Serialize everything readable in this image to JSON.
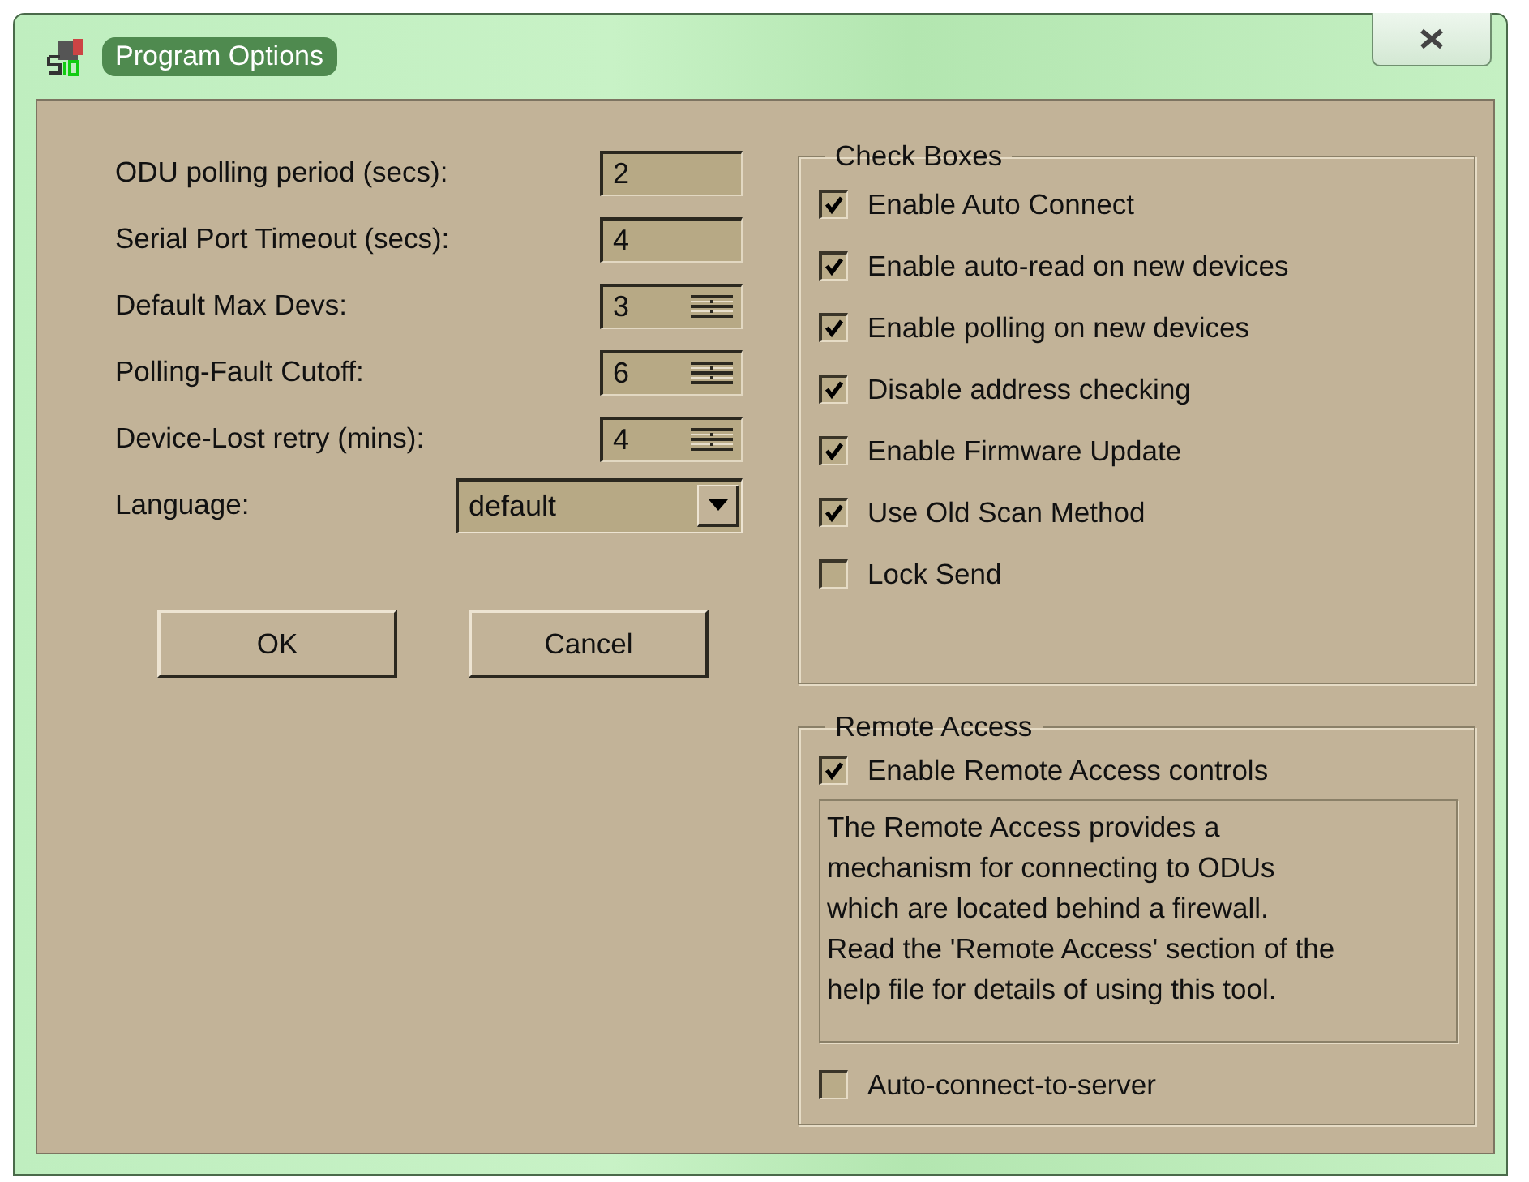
{
  "window": {
    "title": "Program Options"
  },
  "settings": [
    {
      "label": "ODU polling period (secs):",
      "value": "2",
      "kind": "text"
    },
    {
      "label": "Serial Port Timeout (secs):",
      "value": "4",
      "kind": "text"
    },
    {
      "label": "Default Max Devs:",
      "value": "3",
      "kind": "spin"
    },
    {
      "label": "Polling-Fault Cutoff:",
      "value": "6",
      "kind": "spin"
    },
    {
      "label": "Device-Lost retry (mins):",
      "value": "4",
      "kind": "spin"
    },
    {
      "label": "Language:",
      "value": "default",
      "kind": "dropdown"
    }
  ],
  "buttons": [
    "OK",
    "Cancel"
  ],
  "check_boxes": {
    "title": "Check Boxes",
    "items": [
      {
        "label": "Enable Auto Connect",
        "checked": true
      },
      {
        "label": "Enable auto-read on new devices",
        "checked": true
      },
      {
        "label": "Enable polling on new devices",
        "checked": true
      },
      {
        "label": "Disable address checking",
        "checked": true
      },
      {
        "label": "Enable Firmware Update",
        "checked": true
      },
      {
        "label": "Use Old Scan Method",
        "checked": true
      },
      {
        "label": "Lock Send",
        "checked": false
      }
    ]
  },
  "remote_access": {
    "title": "Remote Access",
    "enable": {
      "label": "Enable Remote Access controls",
      "checked": true
    },
    "description": "The Remote Access provides a\nmechanism for connecting to ODUs\nwhich are located behind a firewall.\nRead the 'Remote Access' section of the\nhelp file for details of using this tool.",
    "auto_connect": {
      "label": "Auto-connect-to-server",
      "checked": false
    }
  }
}
